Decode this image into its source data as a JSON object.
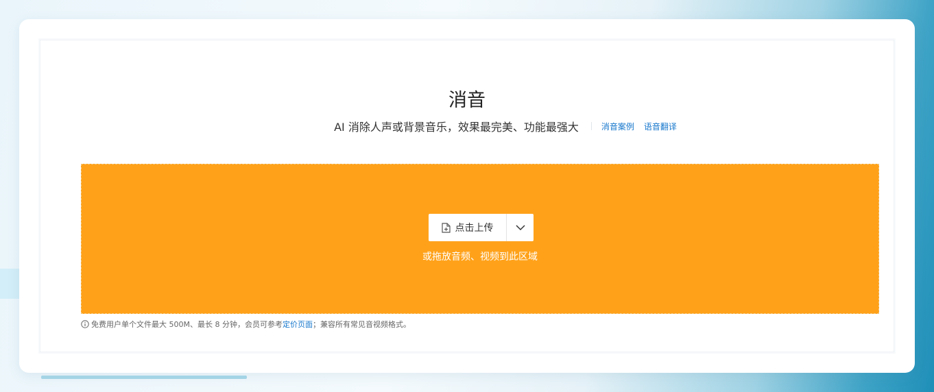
{
  "header": {
    "title": "消音",
    "subtitle": "AI 消除人声或背景音乐，效果最完美、功能最强大",
    "links": [
      {
        "label": "消音案例"
      },
      {
        "label": "语音翻译"
      }
    ]
  },
  "upload": {
    "button_label": "点击上传",
    "drop_hint": "或拖放音频、视频到此区域",
    "dropzone_color": "#ffa21a"
  },
  "note": {
    "text_before": "免费用户单个文件最大 500M、最长 8 分钟，会员可参考",
    "link_label": "定价页面",
    "text_after": "；兼容所有常见音视频格式。"
  },
  "icons": {
    "upload": "file-plus-icon",
    "dropdown": "chevron-down-icon",
    "info": "info-icon"
  }
}
